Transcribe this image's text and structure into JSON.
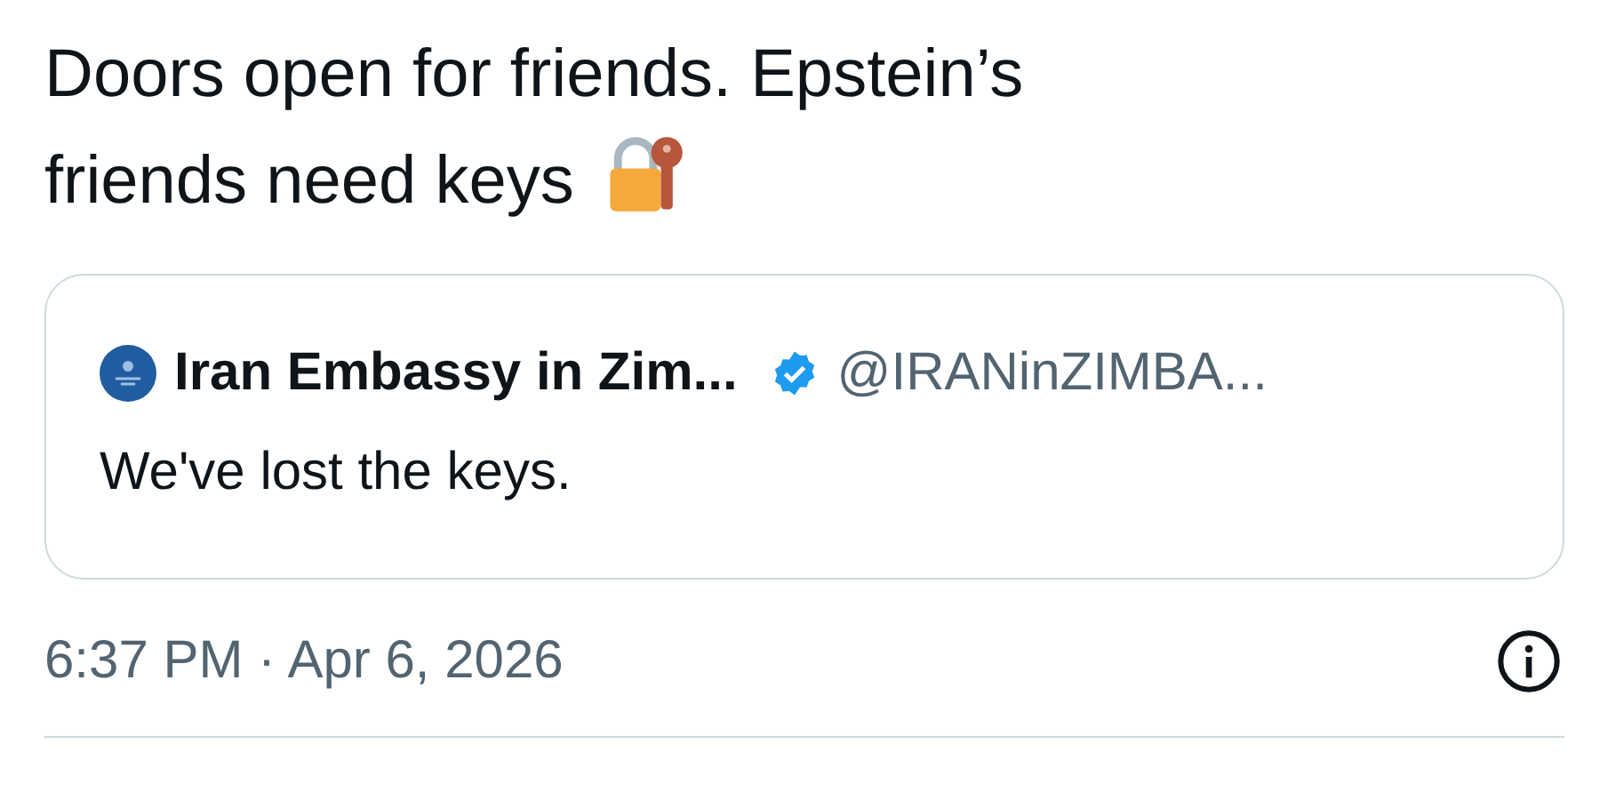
{
  "tweet": {
    "text_lines": [
      "Doors open for friends. Epstein’s",
      "friends need keys"
    ],
    "quoted": {
      "name": "Iran Embassy in Zim...",
      "verified": true,
      "handle": "@IRANinZIMBA...",
      "text": "We've lost the keys."
    },
    "timestamp": "6:37 PM · Apr 6, 2026"
  }
}
